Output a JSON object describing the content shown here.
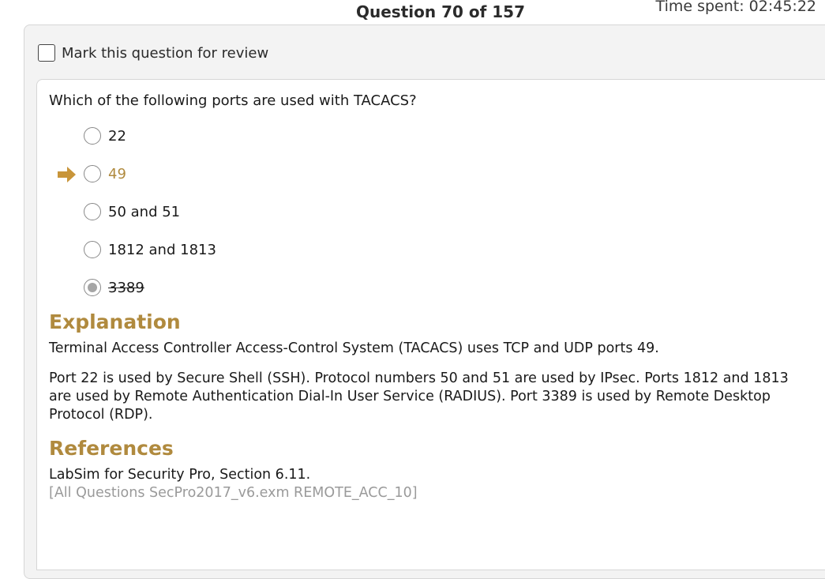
{
  "header": {
    "title": "Question 70 of 157",
    "time_spent": "Time spent: 02:45:22"
  },
  "review": {
    "label": "Mark this question for review",
    "checked": false
  },
  "question": {
    "text": "Which of the following ports are used with TACACS?",
    "options": [
      {
        "label": "22",
        "correct": false,
        "selected": false,
        "struck": false
      },
      {
        "label": "49",
        "correct": true,
        "selected": false,
        "struck": false
      },
      {
        "label": "50 and 51",
        "correct": false,
        "selected": false,
        "struck": false
      },
      {
        "label": "1812 and 1813",
        "correct": false,
        "selected": false,
        "struck": false
      },
      {
        "label": "3389",
        "correct": false,
        "selected": true,
        "struck": true
      }
    ]
  },
  "explanation": {
    "heading": "Explanation",
    "paragraphs": [
      "Terminal Access Controller Access-Control System (TACACS) uses TCP and UDP ports 49.",
      "Port 22 is used by Secure Shell (SSH). Protocol numbers 50 and 51 are used by IPsec. Ports 1812 and 1813 are used by Remote Authentication Dial-In User Service (RADIUS). Port 3389 is used by Remote Desktop Protocol (RDP)."
    ]
  },
  "references": {
    "heading": "References",
    "source": "LabSim for Security Pro, Section 6.11.",
    "question_id": "[All Questions SecPro2017_v6.exm REMOTE_ACC_10]"
  },
  "colors": {
    "accent": "#b08a3e",
    "correct_arrow": "#c8953a",
    "muted_text": "#9a9a9a"
  },
  "icons": {
    "correct_indicator": "right-arrow-icon"
  }
}
